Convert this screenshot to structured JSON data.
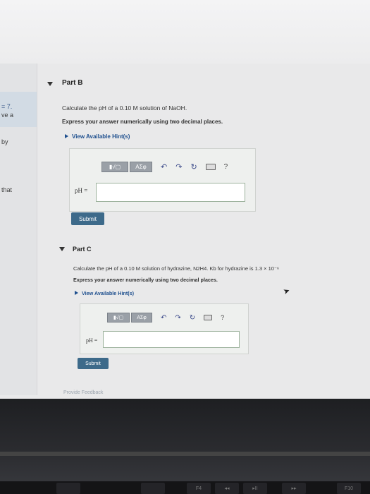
{
  "sidebar": {
    "fragments": [
      "= 7.",
      "ve a",
      "by",
      "that"
    ]
  },
  "part_b": {
    "title": "Part B",
    "question": "Calculate the pH of a 0.10 M solution of NaOH.",
    "instruction": "Express your answer numerically using two decimal places.",
    "hint_link": "View Available Hint(s)",
    "toolbar": {
      "templates_label": "▮√▢",
      "greek_label": "ΑΣφ",
      "help_label": "?"
    },
    "input_label": "pH =",
    "input_value": "",
    "submit_label": "Submit"
  },
  "part_c": {
    "title": "Part C",
    "question": "Calculate the pH of a 0.10 M solution of hydrazine, N2H4. Kb for hydrazine is 1.3 × 10⁻⁶",
    "instruction": "Express your answer numerically using two decimal places.",
    "hint_link": "View Available Hint(s)",
    "toolbar": {
      "templates_label": "▮√▢",
      "greek_label": "ΑΣφ",
      "help_label": "?"
    },
    "input_label": "pH =",
    "input_value": "",
    "submit_label": "Submit"
  },
  "footer": {
    "feedback_link": "Provide Feedback"
  },
  "keyboard": {
    "key_labels": [
      "F4",
      "◂◂",
      "▸II",
      "▸▸",
      "F10"
    ]
  }
}
